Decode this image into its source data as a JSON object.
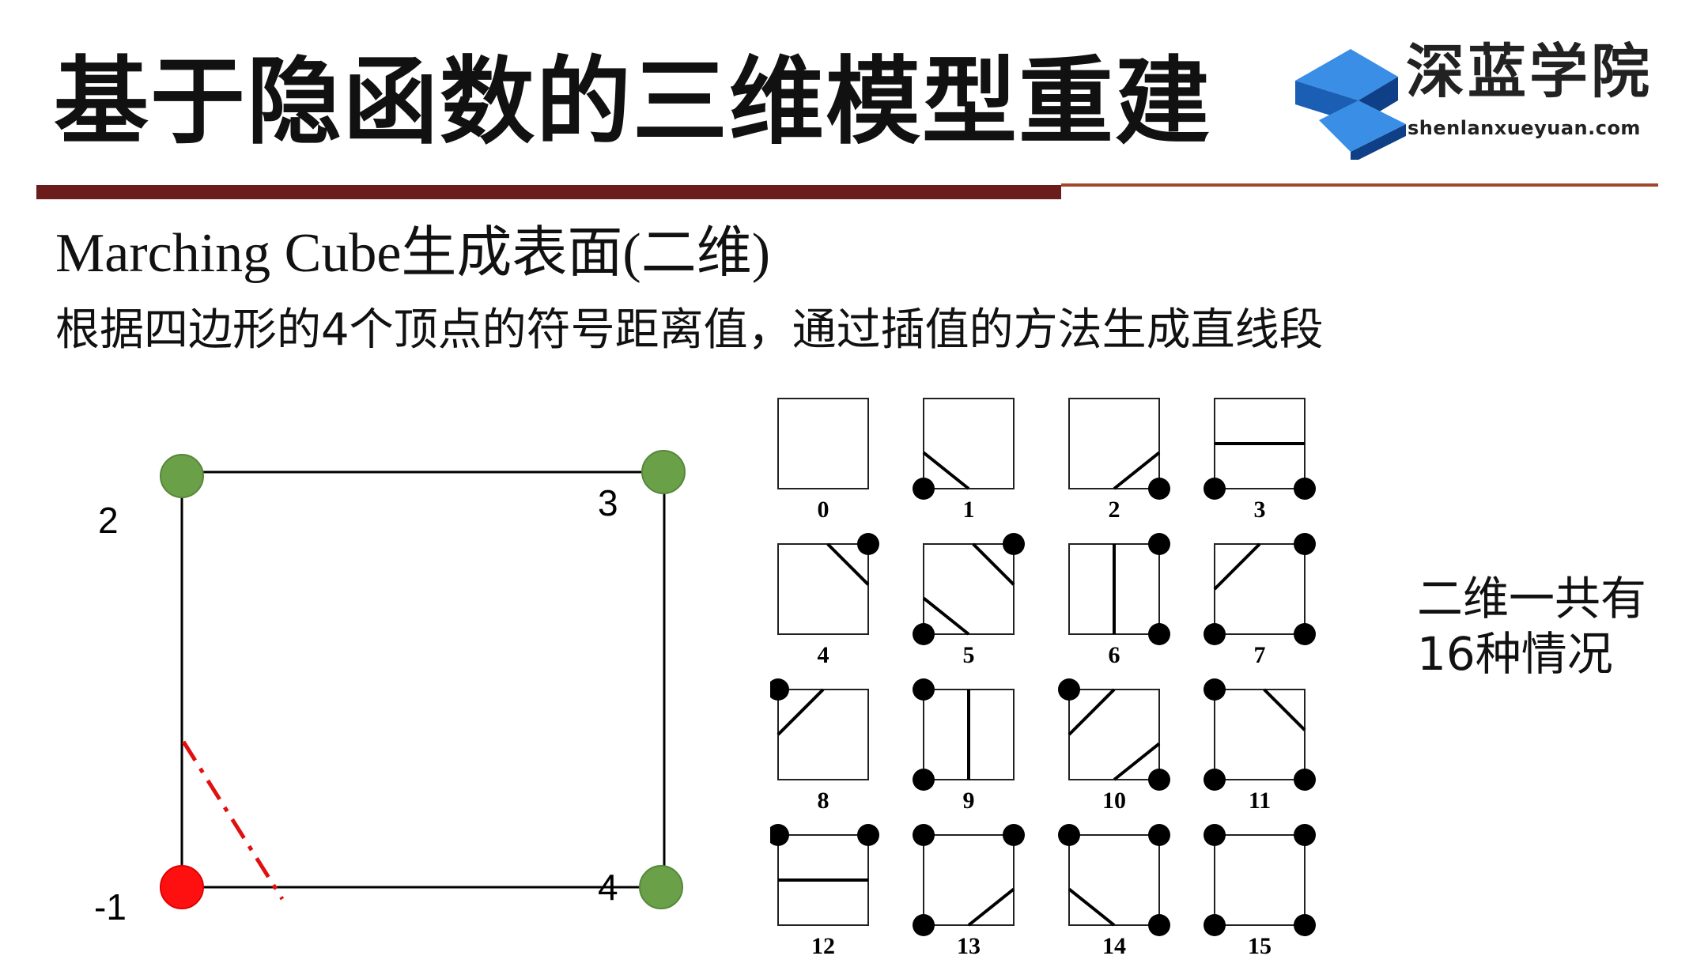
{
  "header": {
    "title": "基于隐函数的三维模型重建",
    "logo_name": "深蓝学院",
    "logo_url": "shenlanxueyuan.com"
  },
  "content": {
    "subtitle": "Marching Cube生成表面(二维)",
    "description": "根据四边形的4个顶点的符号距离值，通过插值的方法生成直线段",
    "vertex_labels": {
      "top_left": "2",
      "top_right": "3",
      "bottom_left": "-1",
      "bottom_right": "4"
    },
    "note_line1": "二维一共有",
    "note_line2": "16种情况"
  },
  "cases": [
    {
      "label": "0"
    },
    {
      "label": "1"
    },
    {
      "label": "2"
    },
    {
      "label": "3"
    },
    {
      "label": "4"
    },
    {
      "label": "5"
    },
    {
      "label": "6"
    },
    {
      "label": "7"
    },
    {
      "label": "8"
    },
    {
      "label": "9"
    },
    {
      "label": "10"
    },
    {
      "label": "11"
    },
    {
      "label": "12"
    },
    {
      "label": "13"
    },
    {
      "label": "14"
    },
    {
      "label": "15"
    }
  ],
  "colors": {
    "positive_vertex": "#6aa048",
    "negative_vertex": "#ff1010",
    "contour_line": "#e01010",
    "header_bar": "#6b1d1d",
    "logo_blue": "#1a5fb4"
  }
}
